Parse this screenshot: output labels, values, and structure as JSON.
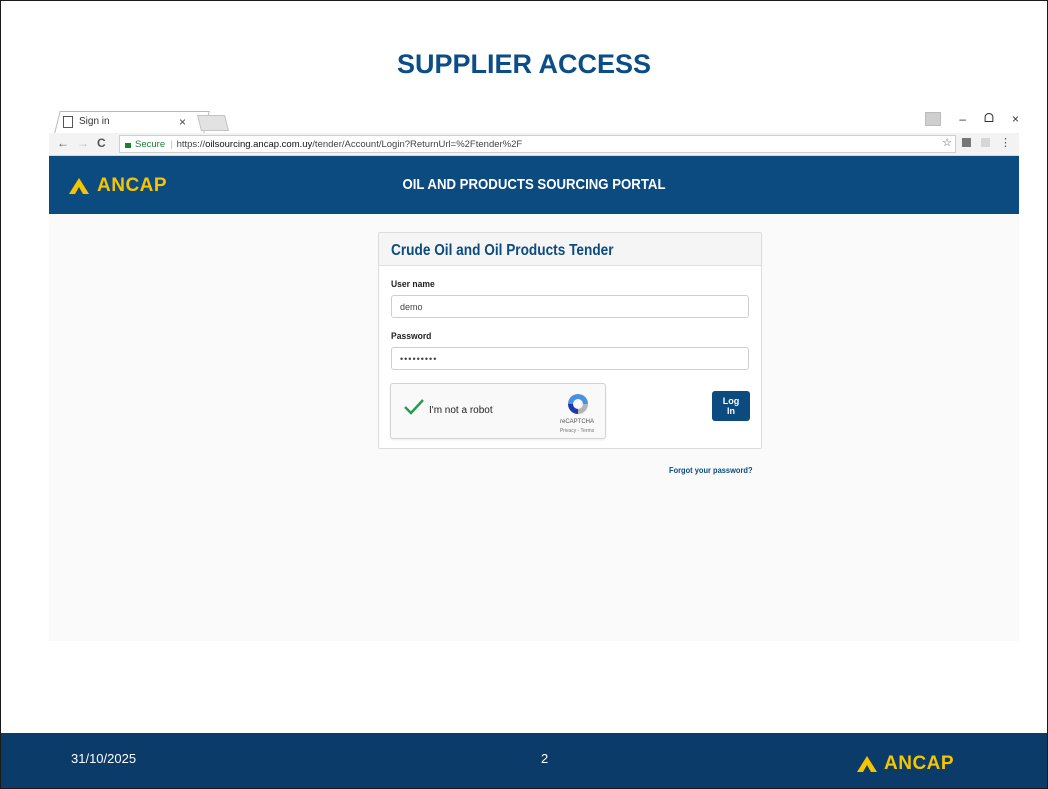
{
  "slide": {
    "title": "SUPPLIER ACCESS",
    "footer": {
      "date": "31/10/2025",
      "page_number": "2",
      "logo_text": "ANCAP"
    }
  },
  "browser": {
    "tab_title": "Sign in",
    "tab_close": "×",
    "window_controls": {
      "minimize": "–",
      "restore": "ᗝ",
      "close": "×"
    },
    "nav": {
      "back": "←",
      "forward": "→",
      "reload": "C"
    },
    "security_label": "Secure",
    "url_prefix": "https://",
    "url_host": "oilsourcing.ancap.com.uy",
    "url_path": "/tender/Account/Login?ReturnUrl=%2Ftender%2F",
    "star": "☆",
    "menu": "⋮"
  },
  "site": {
    "brand": "ANCAP",
    "portal_title": "OIL AND PRODUCTS SOURCING PORTAL",
    "brand_color": "#0b4b80",
    "accent_color": "#f7c400",
    "login_panel": {
      "title": "Crude Oil and Oil Products Tender",
      "username_label": "User name",
      "username_value": "demo",
      "password_label": "Password",
      "password_value": "•••••••••",
      "captcha_label": "I'm not a robot",
      "captcha_brand": "reCAPTCHA",
      "captcha_links": "Privacy - Terms",
      "login_button": "Log In"
    },
    "forgot_password": "Forgot your password?"
  }
}
